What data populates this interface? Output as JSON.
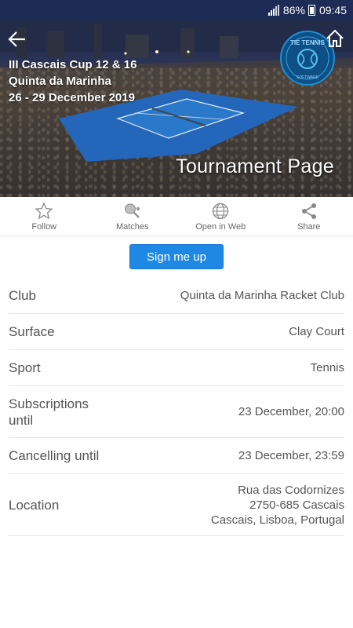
{
  "status_bar": {
    "battery": "86%",
    "time": "09:45"
  },
  "hero": {
    "title_line1": "III Cascais Cup 12 & 16",
    "title_line2": "Quinta da Marinha",
    "title_line3": "26 - 29 December 2019",
    "page_label": "Tournament Page",
    "logo_text_top": "TIE TENNIS",
    "logo_text_bottom": "SOFTWARE"
  },
  "actions": [
    {
      "label": "Follow",
      "icon": "star-icon"
    },
    {
      "label": "Matches",
      "icon": "tennis-racket-icon"
    },
    {
      "label": "Open in Web",
      "icon": "globe-icon"
    },
    {
      "label": "Share",
      "icon": "share-icon"
    }
  ],
  "signup_label": "Sign me up",
  "info": {
    "club": {
      "label": "Club",
      "value": "Quinta da Marinha Racket Club"
    },
    "surface": {
      "label": "Surface",
      "value": "Clay Court"
    },
    "sport": {
      "label": "Sport",
      "value": "Tennis"
    },
    "subscriptions": {
      "label": "Subscriptions until",
      "value": "23 December, 20:00"
    },
    "cancelling": {
      "label": "Cancelling until",
      "value": "23 December, 23:59"
    },
    "location": {
      "label": "Location",
      "line1": "Rua das Codornizes",
      "line2": "2750-685 Cascais",
      "line3": "Cascais, Lisboa, Portugal"
    }
  },
  "colors": {
    "status_bar": "#1d2b55",
    "accent": "#1e88e5",
    "court": "#1f63b8"
  }
}
